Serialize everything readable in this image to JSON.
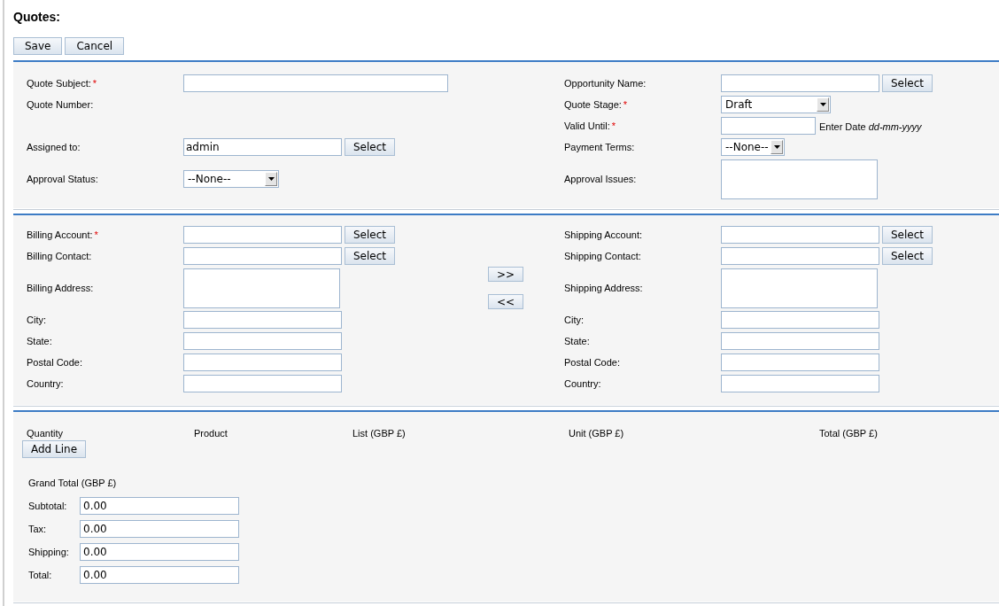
{
  "page_title": "Quotes:",
  "actions": [
    "Save",
    "Cancel"
  ],
  "sections": [
    {
      "kind": "fields",
      "rows": [
        {
          "left": {
            "label": "Quote Subject:",
            "required_mark": "*",
            "kind": "text"
          },
          "right": {
            "label": "Opportunity Name:",
            "kind": "text",
            "button": "Select"
          }
        },
        {
          "left": {
            "label": "Quote Number:",
            "kind": "static"
          },
          "right": {
            "label": "Quote Stage:",
            "required_mark": "*",
            "kind": "select",
            "value": "Draft"
          }
        },
        {
          "right": {
            "label": "Valid Until:",
            "required_mark": "*",
            "kind": "date",
            "hint": "Enter Date *dd-mm-yyyy*"
          }
        },
        {
          "left": {
            "label": "Assigned to:",
            "kind": "text",
            "value": "admin",
            "button": "Select"
          },
          "right": {
            "label": "Payment Terms:",
            "kind": "select",
            "value": "--None--"
          }
        },
        {
          "left": {
            "label": "Approval Status:",
            "kind": "select",
            "value": "--None--"
          },
          "right": {
            "label": "Approval Issues:",
            "kind": "textarea"
          }
        }
      ]
    },
    {
      "kind": "fields",
      "copy_buttons": [
        ">>",
        "<<"
      ],
      "rows": [
        {
          "left": {
            "label": "Billing Account:",
            "required_mark": "*",
            "kind": "text",
            "button": "Select"
          },
          "right": {
            "label": "Shipping Account:",
            "kind": "text",
            "button": "Select"
          }
        },
        {
          "left": {
            "label": "Billing Contact:",
            "kind": "text",
            "button": "Select"
          },
          "right": {
            "label": "Shipping Contact:",
            "kind": "text",
            "button": "Select"
          }
        },
        {
          "left": {
            "label": "Billing Address:",
            "kind": "textarea"
          },
          "right": {
            "label": "Shipping Address:",
            "kind": "textarea"
          }
        },
        {
          "left": {
            "label": "City:",
            "kind": "text"
          },
          "right": {
            "label": "City:",
            "kind": "text"
          }
        },
        {
          "left": {
            "label": "State:",
            "kind": "text"
          },
          "right": {
            "label": "State:",
            "kind": "text"
          }
        },
        {
          "left": {
            "label": "Postal Code:",
            "kind": "text"
          },
          "right": {
            "label": "Postal Code:",
            "kind": "text"
          }
        },
        {
          "left": {
            "label": "Country:",
            "kind": "text"
          },
          "right": {
            "label": "Country:",
            "kind": "text"
          }
        }
      ]
    },
    {
      "kind": "line_items",
      "columns": [
        "Quantity",
        "Product",
        "List (GBP £)",
        "Unit (GBP £)",
        "Total (GBP £)"
      ],
      "add_button": "Add Line",
      "grand_total": {
        "title": "Grand Total (GBP £)",
        "rows": [
          {
            "label": "Subtotal:",
            "value": "0.00"
          },
          {
            "label": "Tax:",
            "value": "0.00"
          },
          {
            "label": "Shipping:",
            "value": "0.00"
          },
          {
            "label": "Total:",
            "value": "0.00"
          }
        ]
      }
    }
  ]
}
